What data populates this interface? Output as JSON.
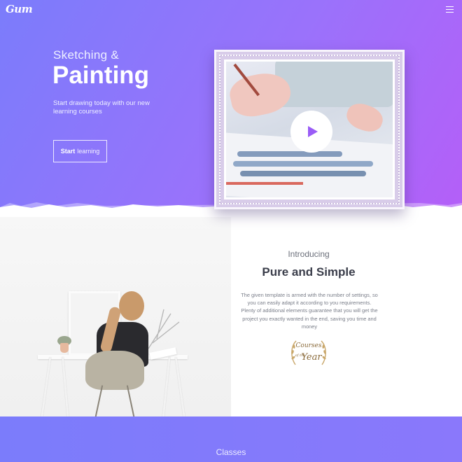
{
  "header": {
    "logo_text": "Gum",
    "menu_icon": "hamburger-menu-icon"
  },
  "hero": {
    "pre_title": "Sketching &",
    "title": "Painting",
    "subtitle": "Start drawing today with our new learning courses",
    "cta_bold": "Start",
    "cta_light": "learning",
    "play_icon": "play-icon",
    "colors": {
      "gradient_start": "#7b7cfb",
      "gradient_end": "#b45ff8",
      "play": "#9a5cf6"
    }
  },
  "intro": {
    "pre_title": "Introducing",
    "title": "Pure and Simple",
    "description": "The given template is armed with the number of settings, so you can easily adapt it according to you requirements. Plenty of additional elements guarantee that you will get the project you exactly wanted in the end, saving you time and money",
    "badge": {
      "line1": "Courses",
      "line2": "of the",
      "line3": "Year"
    }
  },
  "classes": {
    "title": "Classes"
  }
}
